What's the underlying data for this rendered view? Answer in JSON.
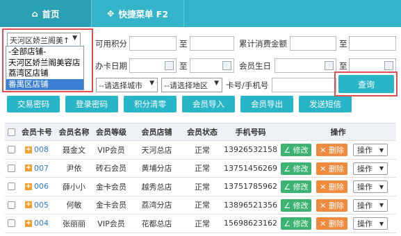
{
  "nav": {
    "home": "首页",
    "quick_menu": "快捷菜单 F2"
  },
  "filters": {
    "store_select": "天河区娇兰阁美↑",
    "points_label": "可用积分",
    "to1": "至",
    "consume_label": "累计消费金额",
    "to2": "至",
    "card_date_label": "办卡日期",
    "to3": "至",
    "birthday_label": "会员生日",
    "to4": "至",
    "city_select": "--请选择城市",
    "area_select": "--请选择地区",
    "card_phone_label": "卡号/手机号",
    "query": "查询"
  },
  "store_options": [
    "-全部店铺-",
    "天河区娇兰阁美容店",
    "荔湾区店铺",
    "番禺区店铺"
  ],
  "store_selected_index": 3,
  "actions": [
    "交易密码",
    "登录密码",
    "积分清零",
    "会员导入",
    "会员导出",
    "发送短信"
  ],
  "table": {
    "headers": [
      "会员卡号",
      "会员名称",
      "会员等级",
      "会员店铺",
      "会员状态",
      "手机号码",
      "操作"
    ],
    "rows": [
      {
        "card": "008",
        "name": "聂金文",
        "level": "VIP会员",
        "store": "天河总店",
        "status": "正常",
        "phone": "13926532158"
      },
      {
        "card": "007",
        "name": "尹依",
        "level": "砖石会员",
        "store": "黄埔分店",
        "status": "正常",
        "phone": "13751456269"
      },
      {
        "card": "006",
        "name": "薛小小",
        "level": "金卡会员",
        "store": "越秀总店",
        "status": "正常",
        "phone": "13751785962"
      },
      {
        "card": "005",
        "name": "何敏",
        "level": "金卡会员",
        "store": "荔湾分店",
        "status": "正常",
        "phone": "13896521356"
      },
      {
        "card": "004",
        "name": "张丽丽",
        "level": "VIP会员",
        "store": "花都总店",
        "status": "正常",
        "phone": "15698623162"
      }
    ],
    "edit_label": "∠ 修改",
    "delete_label": "✕ 删除",
    "op_label": "操作"
  },
  "colors": {
    "topbar": "#33b4c8",
    "button": "#29b5c8",
    "edit": "#3cb371",
    "delete": "#f08a3c",
    "highlight": "#e05050"
  }
}
